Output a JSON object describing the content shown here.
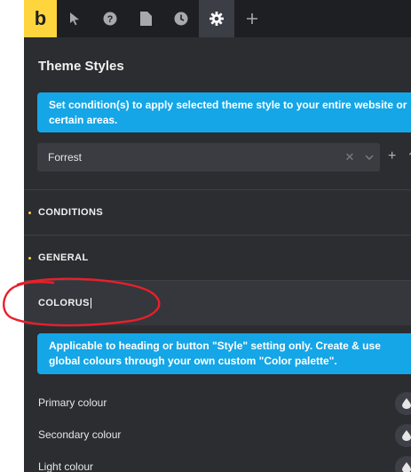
{
  "toolbar": {
    "logo_text": "b",
    "icons": [
      "pointer-icon",
      "help-icon",
      "page-icon",
      "history-icon",
      "settings-icon",
      "add-icon"
    ],
    "active": "settings-icon"
  },
  "panel": {
    "title": "Theme Styles",
    "condition_info": "Set condition(s) to apply selected theme style to your entire website or certain areas.",
    "selected_style": "Forrest",
    "add_label": "+"
  },
  "sections": {
    "conditions": "CONDITIONS",
    "general": "GENERAL",
    "colorus": "COLORUS"
  },
  "colors_info": "Applicable to heading or button \"Style\" setting only. Create & use global colours through your own custom \"Color palette\".",
  "color_rows": [
    {
      "label": "Primary colour"
    },
    {
      "label": "Secondary colour"
    },
    {
      "label": "Light colour"
    }
  ],
  "accent_colors": {
    "brand": "#ffd53e",
    "info": "#14a6e7",
    "annotation": "#e8202a"
  }
}
